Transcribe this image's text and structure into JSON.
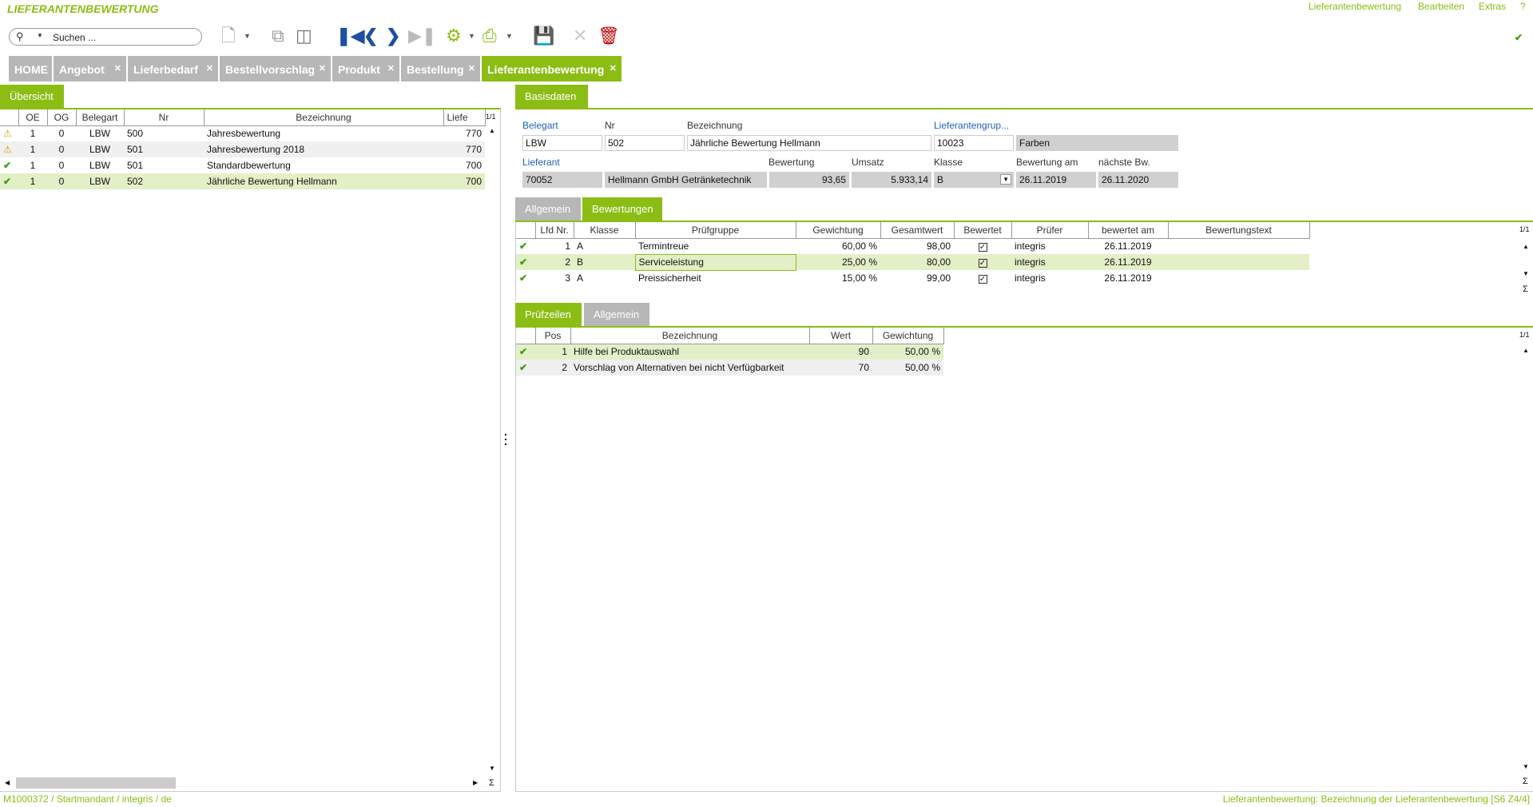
{
  "app": {
    "title": "LIEFERANTENBEWERTUNG",
    "menu": [
      "Lieferantenbewertung",
      "Bearbeiten",
      "Extras",
      "?"
    ]
  },
  "search": {
    "placeholder": "Suchen ..."
  },
  "tabs": [
    {
      "label": "HOME",
      "closable": false
    },
    {
      "label": "Angebot",
      "closable": true
    },
    {
      "label": "Lieferbedarf",
      "closable": true
    },
    {
      "label": "Bestellvorschlag",
      "closable": true
    },
    {
      "label": "Produkt",
      "closable": true
    },
    {
      "label": "Bestellung",
      "closable": true
    },
    {
      "label": "Lieferantenbewertung",
      "closable": true,
      "active": true
    }
  ],
  "left": {
    "tab": "Übersicht",
    "pager": "1/1",
    "columns": [
      "OE",
      "OG",
      "Belegart",
      "Nr",
      "Bezeichnung",
      "Liefe"
    ],
    "rows": [
      {
        "status": "warn",
        "oe": "1",
        "og": "0",
        "belegart": "LBW",
        "nr": "500",
        "bez": "Jahresbewertung",
        "lief": "770"
      },
      {
        "status": "warn",
        "oe": "1",
        "og": "0",
        "belegart": "LBW",
        "nr": "501",
        "bez": "Jahresbewertung 2018",
        "lief": "770"
      },
      {
        "status": "ok",
        "oe": "1",
        "og": "0",
        "belegart": "LBW",
        "nr": "501",
        "bez": "Standardbewertung",
        "lief": "700"
      },
      {
        "status": "ok",
        "oe": "1",
        "og": "0",
        "belegart": "LBW",
        "nr": "502",
        "bez": "Jährliche Bewertung Hellmann",
        "lief": "700"
      }
    ]
  },
  "basis": {
    "tab": "Basisdaten",
    "labels": {
      "belegart": "Belegart",
      "nr": "Nr",
      "bez": "Bezeichnung",
      "lgrp": "Lieferantengrup...",
      "lieferant": "Lieferant",
      "bewertung": "Bewertung",
      "umsatz": "Umsatz",
      "klasse": "Klasse",
      "bewam": "Bewertung am",
      "naechste": "nächste Bw."
    },
    "values": {
      "belegart": "LBW",
      "nr": "502",
      "bez": "Jährliche Bewertung Hellmann",
      "lgrp": "10023",
      "lgrp_name": "Farben",
      "lieferant": "70052",
      "lieferant_name": "Hellmann GmbH Getränketechnik",
      "bewertung": "93,65",
      "umsatz": "5.933,14",
      "klasse": "B",
      "bewam": "26.11.2019",
      "naechste": "26.11.2020"
    }
  },
  "bew": {
    "tabs": [
      "Allgemein",
      "Bewertungen"
    ],
    "pager": "1/1",
    "columns": [
      "Lfd Nr.",
      "Klasse",
      "Prüfgruppe",
      "Gewichtung",
      "Gesamtwert",
      "Bewertet",
      "Prüfer",
      "bewertet am",
      "Bewertungstext"
    ],
    "rows": [
      {
        "nr": "1",
        "klasse": "A",
        "gruppe": "Termintreue",
        "gew": "60,00 %",
        "ges": "98,00",
        "pruefer": "integris",
        "am": "26.11.2019",
        "text": ""
      },
      {
        "nr": "2",
        "klasse": "B",
        "gruppe": "Serviceleistung",
        "gew": "25,00 %",
        "ges": "80,00",
        "pruefer": "integris",
        "am": "26.11.2019",
        "text": ""
      },
      {
        "nr": "3",
        "klasse": "A",
        "gruppe": "Preissicherheit",
        "gew": "15,00 %",
        "ges": "99,00",
        "pruefer": "integris",
        "am": "26.11.2019",
        "text": ""
      }
    ]
  },
  "pz": {
    "tabs": [
      "Prüfzeilen",
      "Allgemein"
    ],
    "pager": "1/1",
    "columns": [
      "Pos",
      "Bezeichnung",
      "Wert",
      "Gewichtung"
    ],
    "rows": [
      {
        "pos": "1",
        "bez": "Hilfe bei Produktauswahl",
        "wert": "90",
        "gew": "50,00 %"
      },
      {
        "pos": "2",
        "bez": "Vorschlag von Alternativen bei nicht Verfügbarkeit",
        "wert": "70",
        "gew": "50,00 %"
      }
    ]
  },
  "status": {
    "left": "M1000372 / Startmandant / integris / de",
    "right": "Lieferantenbewertung: Bezeichnung der Lieferantenbewertung [S6 Z4/4]"
  },
  "colors": {
    "accent": "#8cbd14",
    "tab_inactive": "#b7b7b7",
    "selected_row": "#e3efc7",
    "link_label": "#1f5fbf"
  }
}
